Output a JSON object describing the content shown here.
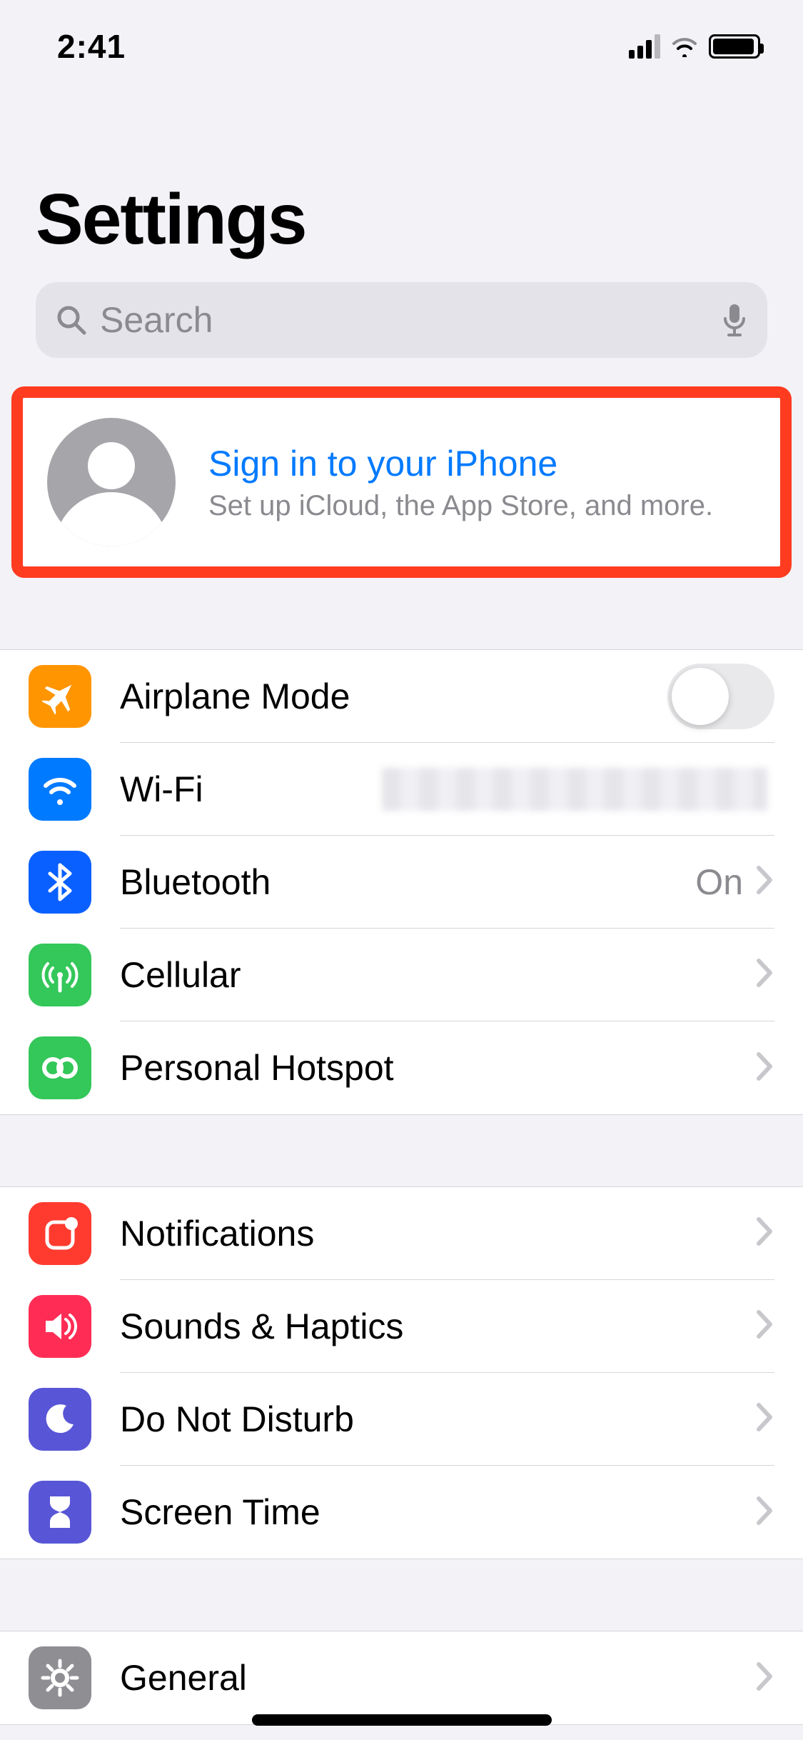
{
  "status": {
    "time": "2:41"
  },
  "page": {
    "title": "Settings"
  },
  "search": {
    "placeholder": "Search"
  },
  "signin": {
    "title": "Sign in to your iPhone",
    "subtitle": "Set up iCloud, the App Store, and more."
  },
  "group1": {
    "airplane": {
      "label": "Airplane Mode",
      "on": false
    },
    "wifi": {
      "label": "Wi-Fi"
    },
    "bluetooth": {
      "label": "Bluetooth",
      "value": "On"
    },
    "cellular": {
      "label": "Cellular"
    },
    "personalHotspot": {
      "label": "Personal Hotspot"
    }
  },
  "group2": {
    "notifications": {
      "label": "Notifications"
    },
    "sounds": {
      "label": "Sounds & Haptics"
    },
    "dnd": {
      "label": "Do Not Disturb"
    },
    "screentime": {
      "label": "Screen Time"
    }
  },
  "group3": {
    "general": {
      "label": "General"
    }
  }
}
